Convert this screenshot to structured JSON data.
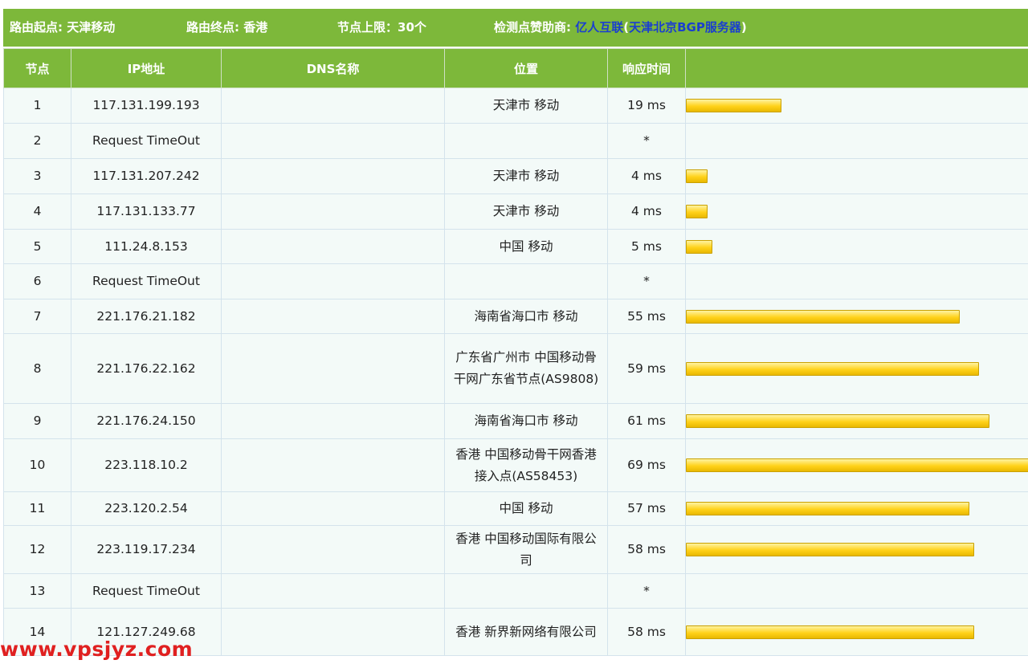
{
  "header": {
    "start_label": "路由起点: ",
    "start_value": "天津移动",
    "end_label": "路由终点: ",
    "end_value": "香港",
    "limit_label": "节点上限：",
    "limit_value": "30个",
    "sponsor_label": "检测点赞助商: ",
    "sponsor_name": "亿人互联",
    "sponsor_detail_open": "(",
    "sponsor_detail": "天津北京BGP服务器",
    "sponsor_detail_close": ")"
  },
  "columns": [
    "节点",
    "IP地址",
    "DNS名称",
    "位置",
    "响应时间",
    ""
  ],
  "rows": [
    {
      "node": "1",
      "ip": "117.131.199.193",
      "dns": "",
      "location": "天津市 移动",
      "time": "19 ms",
      "time_ms": 19
    },
    {
      "node": "2",
      "ip": "Request TimeOut",
      "dns": "",
      "location": "",
      "time": "*",
      "time_ms": 0
    },
    {
      "node": "3",
      "ip": "117.131.207.242",
      "dns": "",
      "location": "天津市 移动",
      "time": "4 ms",
      "time_ms": 4
    },
    {
      "node": "4",
      "ip": "117.131.133.77",
      "dns": "",
      "location": "天津市 移动",
      "time": "4 ms",
      "time_ms": 4
    },
    {
      "node": "5",
      "ip": "111.24.8.153",
      "dns": "",
      "location": "中国 移动",
      "time": "5 ms",
      "time_ms": 5
    },
    {
      "node": "6",
      "ip": "Request TimeOut",
      "dns": "",
      "location": "",
      "time": "*",
      "time_ms": 0
    },
    {
      "node": "7",
      "ip": "221.176.21.182",
      "dns": "",
      "location": "海南省海口市 移动",
      "time": "55 ms",
      "time_ms": 55
    },
    {
      "node": "8",
      "ip": "221.176.22.162",
      "dns": "",
      "location": "广东省广州市 中国移动骨干网广东省节点(AS9808)",
      "time": "59 ms",
      "time_ms": 59
    },
    {
      "node": "9",
      "ip": "221.176.24.150",
      "dns": "",
      "location": "海南省海口市 移动",
      "time": "61 ms",
      "time_ms": 61
    },
    {
      "node": "10",
      "ip": "223.118.10.2",
      "dns": "",
      "location": "香港 中国移动骨干网香港接入点(AS58453)",
      "time": "69 ms",
      "time_ms": 69
    },
    {
      "node": "11",
      "ip": "223.120.2.54",
      "dns": "",
      "location": "中国 移动",
      "time": "57 ms",
      "time_ms": 57
    },
    {
      "node": "12",
      "ip": "223.119.17.234",
      "dns": "",
      "location": "香港 中国移动国际有限公司",
      "time": "58 ms",
      "time_ms": 58
    },
    {
      "node": "13",
      "ip": "Request TimeOut",
      "dns": "",
      "location": "",
      "time": "*",
      "time_ms": 0
    },
    {
      "node": "14",
      "ip": "121.127.249.68",
      "dns": "",
      "location": "香港 新界新网络有限公司",
      "time": "58 ms",
      "time_ms": 58
    }
  ],
  "bar_max_ms": 69,
  "colors": {
    "header_green": "#7db83a",
    "row_bg": "#f3faf8",
    "bar_yellow": "#ffd21a",
    "sponsor_blue": "#1a3fcf",
    "watermark_red": "#e02020"
  },
  "watermark": "www.vpsjyz.com"
}
